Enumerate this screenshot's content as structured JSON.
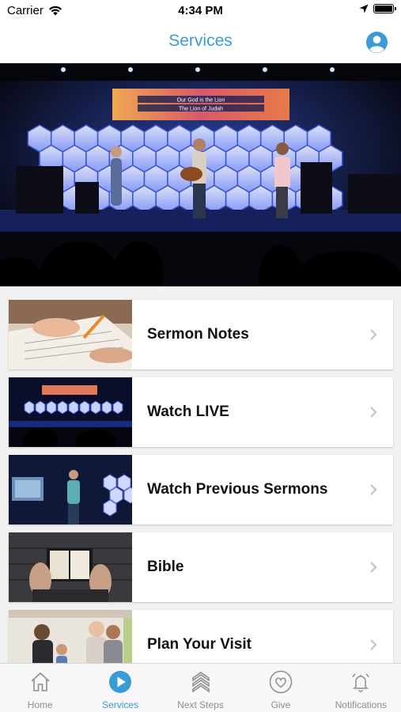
{
  "status_bar": {
    "carrier": "Carrier",
    "time": "4:34 PM"
  },
  "nav": {
    "title": "Services"
  },
  "hero": {
    "screen_line1": "Our God is the Lion",
    "screen_line2": "The Lion of Judah"
  },
  "menu": [
    {
      "label": "Sermon Notes"
    },
    {
      "label": "Watch LIVE"
    },
    {
      "label": "Watch Previous Sermons"
    },
    {
      "label": "Bible"
    },
    {
      "label": "Plan Your Visit"
    }
  ],
  "tabs": [
    {
      "label": "Home",
      "icon": "home-icon"
    },
    {
      "label": "Services",
      "icon": "play-icon",
      "active": true
    },
    {
      "label": "Next Steps",
      "icon": "chevrons-up-icon"
    },
    {
      "label": "Give",
      "icon": "heart-icon"
    },
    {
      "label": "Notifications",
      "icon": "bell-icon"
    }
  ],
  "colors": {
    "accent": "#3a9bd5",
    "inactive": "#8e8e93"
  }
}
